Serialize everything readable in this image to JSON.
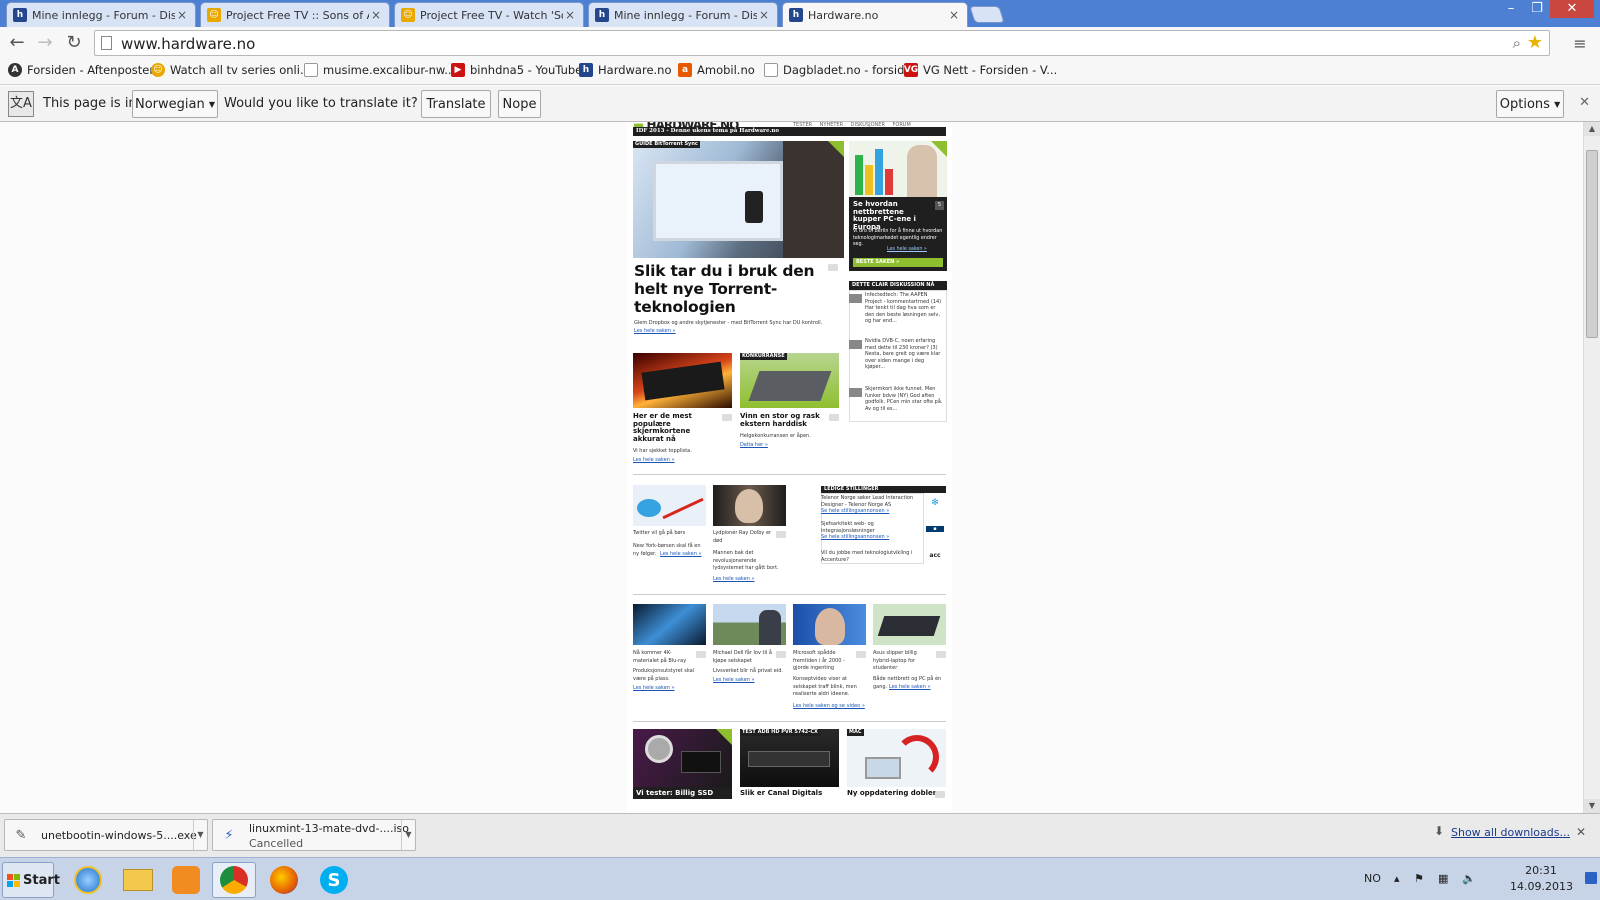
{
  "browser": {
    "tabs": [
      {
        "title": "Mine innlegg - Forum - Diskus",
        "icon": "hardware-favicon-icon",
        "color": "#24468c"
      },
      {
        "title": "Project Free TV :: Sons of Ar",
        "icon": "projectfreetv-favicon-icon",
        "color": "#e8a800"
      },
      {
        "title": "Project Free TV - Watch 'Sor",
        "icon": "projectfreetv-favicon-icon",
        "color": "#e8a800"
      },
      {
        "title": "Mine innlegg - Forum - Diskus",
        "icon": "hardware-favicon-icon",
        "color": "#24468c"
      },
      {
        "title": "Hardware.no",
        "icon": "hardware-favicon-icon",
        "color": "#24468c",
        "active": true
      }
    ],
    "url": "www.hardware.no",
    "bookmarks": [
      {
        "label": "Forsiden - Aftenposten",
        "icon": "aftenposten-icon",
        "color": "#333"
      },
      {
        "label": "Watch all tv series onli...",
        "icon": "projectfreetv-favicon-icon",
        "color": "#e8a800"
      },
      {
        "label": "musime.excalibur-nw....",
        "icon": "page-icon",
        "color": "#999"
      },
      {
        "label": "binhdna5 - YouTube",
        "icon": "youtube-icon",
        "color": "#cc1111"
      },
      {
        "label": "Hardware.no",
        "icon": "hardware-favicon-icon",
        "color": "#24468c"
      },
      {
        "label": "Amobil.no",
        "icon": "amobil-icon",
        "color": "#e85a00"
      },
      {
        "label": "Dagbladet.no - forsiden",
        "icon": "page-icon",
        "color": "#999"
      },
      {
        "label": "VG Nett - Forsiden - V...",
        "icon": "vg-icon",
        "color": "#cc1111"
      }
    ],
    "translate": {
      "prefix": "This page is in",
      "language": "Norwegian",
      "question": "Would you like to translate it?",
      "translate_button": "Translate",
      "nope_button": "Nope",
      "options_button": "Options"
    }
  },
  "site": {
    "logo": "HARDWARE.NO",
    "topnav": "TESTER NYHETER DISKUSJONER FORUM",
    "banner": "IDF 2013 - Denne ukens tema på Hardware.no",
    "main_story": {
      "tag": "GUIDE",
      "tag_sub": "BitTorrent Sync",
      "headline": "Slik tar du i bruk den helt nye Torrent-teknologien",
      "lead": "Glem Dropbox og andre skytjenester - med BitTorrent Sync har DU kontroll.",
      "link": "Les hele saken »"
    },
    "side_story": {
      "headline": "Se hvordan nettbrettene kupper PC-ene i Europa",
      "lead": "Vi dro til Berlin for å finne ut hvordan teknologimarkedet egentlig endrer seg.",
      "link": "Les hele saken »",
      "cta": "BESTE SAKEN »",
      "count": "5"
    },
    "story2": {
      "headline": "Her er de mest populære skjermkortene akkurat nå",
      "lead": "Vi har sjekket topplista.",
      "link": "Les hele saken »"
    },
    "story3": {
      "tag": "KONKURRANSE",
      "headline": "Vinn en stor og rask ekstern harddisk",
      "lead": "Helgekonkurransen er åpen.",
      "link": "Delta her »"
    },
    "comments": {
      "title": "DETTE CLAIR DISKUSSION NÅ",
      "items": [
        "Infectedtech: The AAPEN Project - kommentartrned (14)",
        "Nvidia DVB-C, noen erfaring med dette til 230 kroner? (3)",
        "Skjermkort ikke funnet. Men funker bdvw (NY)"
      ],
      "bodies": [
        "Har tenkt til dag hva som er den den beste løsningen selv, og har end...",
        "Nesta, bare greit og være klar over siden mange i deg kjøper...",
        "God aften godfolk. PCen min star ofte på. Av og til es..."
      ]
    },
    "row3": [
      {
        "headline": "Twitter vil gå på børs",
        "lead": "New York-børsen skal få en ny følger.",
        "link": "Les hele saken »"
      },
      {
        "headline": "Lydpionér Ray Dolby er død",
        "lead": "Mannen bak det revolusjonerende lydsystemet har gått bort.",
        "link": "Les hele saken »"
      }
    ],
    "jobs": {
      "title": "LEDIGE STILLINGER",
      "items": [
        {
          "text": "Telenor Norge søker Lead Interaction Designer - Telenor Norge AS",
          "link": "Se hele stillingsannonsen »"
        },
        {
          "text": "Sjefsarkitekt web- og integrasjonsløsninger",
          "link": "Se hele stillingsannonsen »"
        },
        {
          "text": "Vil du jobbe med teknologiutvikling i Accenture?",
          "link": ""
        }
      ]
    },
    "row4": [
      {
        "headline": "Nå kommer 4K-materialet på Blu-ray",
        "lead": "Produksjonsutstyret skal være på plass.",
        "link": "Les hele saken »"
      },
      {
        "headline": "Michael Dell får lov til å kjøpe selskapet",
        "lead": "Livsverket blir nå privat eid.",
        "link": "Les hele saken »"
      },
      {
        "headline": "Microsoft spådde fremtiden i år 2000 - gjorde ingenting",
        "lead": "Konseptvideo viser at selskapet traff blink, men realiserte aldri ideene.",
        "link": "Les hele saken og se video »"
      },
      {
        "headline": "Asus slipper billig hybrid-laptop for studenter",
        "lead": "Både nettbrett og PC på én gang.",
        "link": "Les hele saken »"
      }
    ],
    "row5": [
      {
        "tag": "",
        "headline": "Vi tester: Billig SSD"
      },
      {
        "tag": "TEST",
        "tag_sub": "ADB HD PVR 5742-CX",
        "headline": "Slik er Canal Digitals"
      },
      {
        "tag": "MAC",
        "headline": "Ny oppdatering dobler"
      }
    ]
  },
  "downloads": {
    "items": [
      {
        "name": "unetbootin-windows-5....exe",
        "status": ""
      },
      {
        "name": "linuxmint-13-mate-dvd-....iso",
        "status": "Cancelled"
      }
    ],
    "show_all": "Show all downloads..."
  },
  "taskbar": {
    "start": "Start",
    "lang": "NO",
    "time": "20:31",
    "date": "14.09.2013"
  }
}
